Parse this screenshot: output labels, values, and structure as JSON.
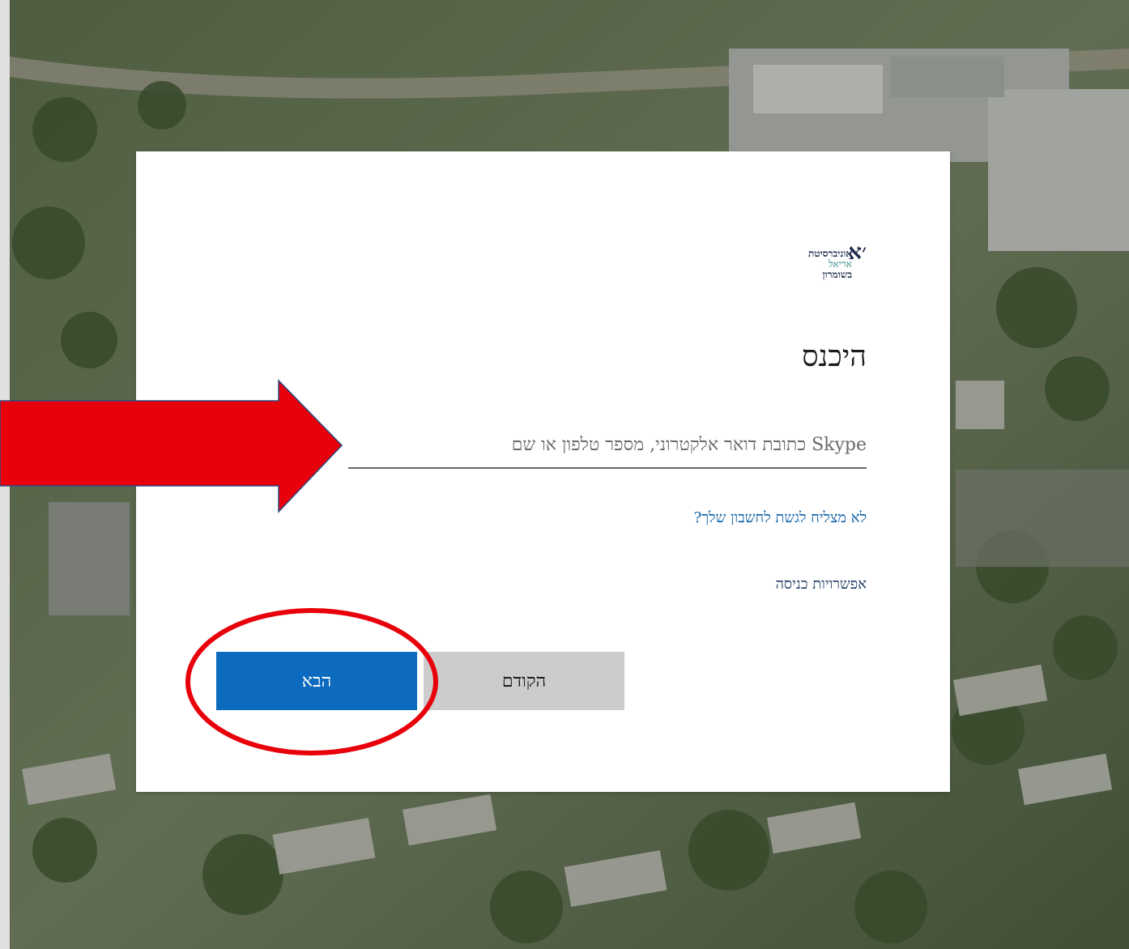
{
  "logo": {
    "mark": "׳א",
    "line1": "אוניברסיטת",
    "line2": "אריאל",
    "line3": "בשומרון"
  },
  "signin": {
    "title": "היכנס",
    "input_placeholder": "Skype כתובת דואר אלקטרוני, מספר טלפון או שם",
    "forgot_link": "לא מצליח לגשת לחשבון שלך?",
    "options_link": "אפשרויות כניסה",
    "next_label": "הבא",
    "back_label": "הקודם"
  },
  "colors": {
    "primary": "#0c6abf",
    "link": "#0b5fa8",
    "annotation": "#e8000a"
  }
}
